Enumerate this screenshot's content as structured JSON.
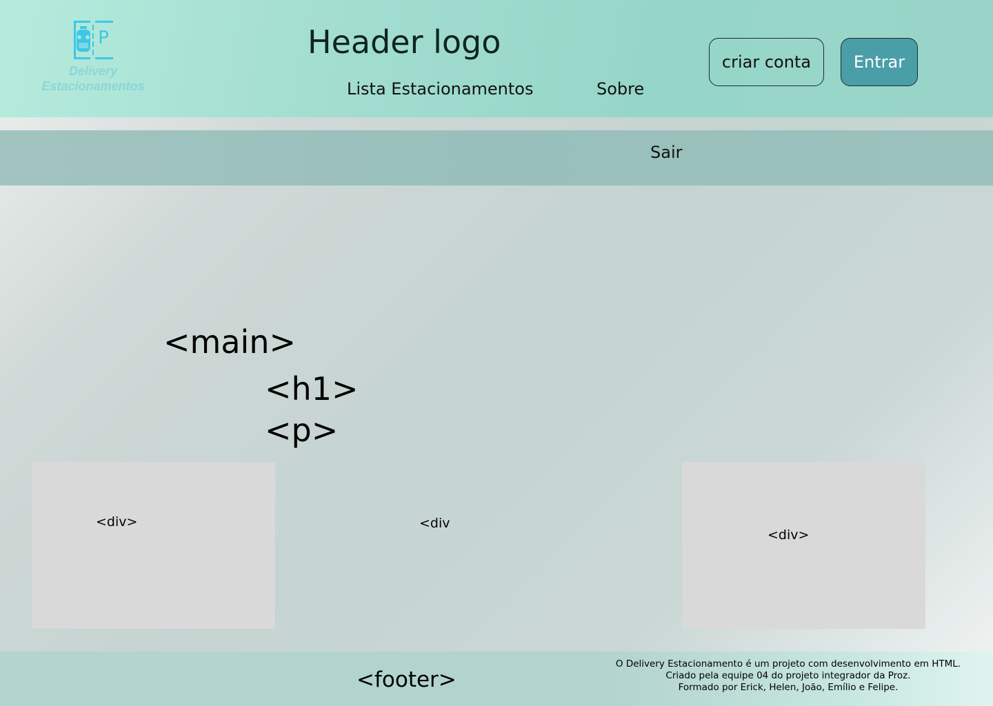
{
  "header": {
    "logo": {
      "mark_letter": "P",
      "line1": "Delivery",
      "line2": "Estacionamentos",
      "color": "#8bd6d8",
      "mark_color": "#3ec7e6"
    },
    "title": "Header logo",
    "nav": [
      {
        "label": "Lista Estacionamentos"
      },
      {
        "label": "Sobre"
      }
    ],
    "buttons": {
      "create_account": "criar conta",
      "login": "Entrar"
    },
    "login_button_color": "#4a9ea8"
  },
  "subbar": {
    "logout": "Sair"
  },
  "main": {
    "main_tag": "<main>",
    "h1_tag": "<h1>",
    "p_tag": "<p>",
    "div_left": "<div>",
    "div_middle": "<div",
    "div_right": "<div>"
  },
  "footer": {
    "tag": "<footer>",
    "lines": [
      "O Delivery Estacionamento é um projeto com desenvolvimento em HTML.",
      "Criado pela equipe 04 do projeto integrador da Proz.",
      "Formado por Erick, Helen, João, Emílio e Felipe."
    ]
  }
}
